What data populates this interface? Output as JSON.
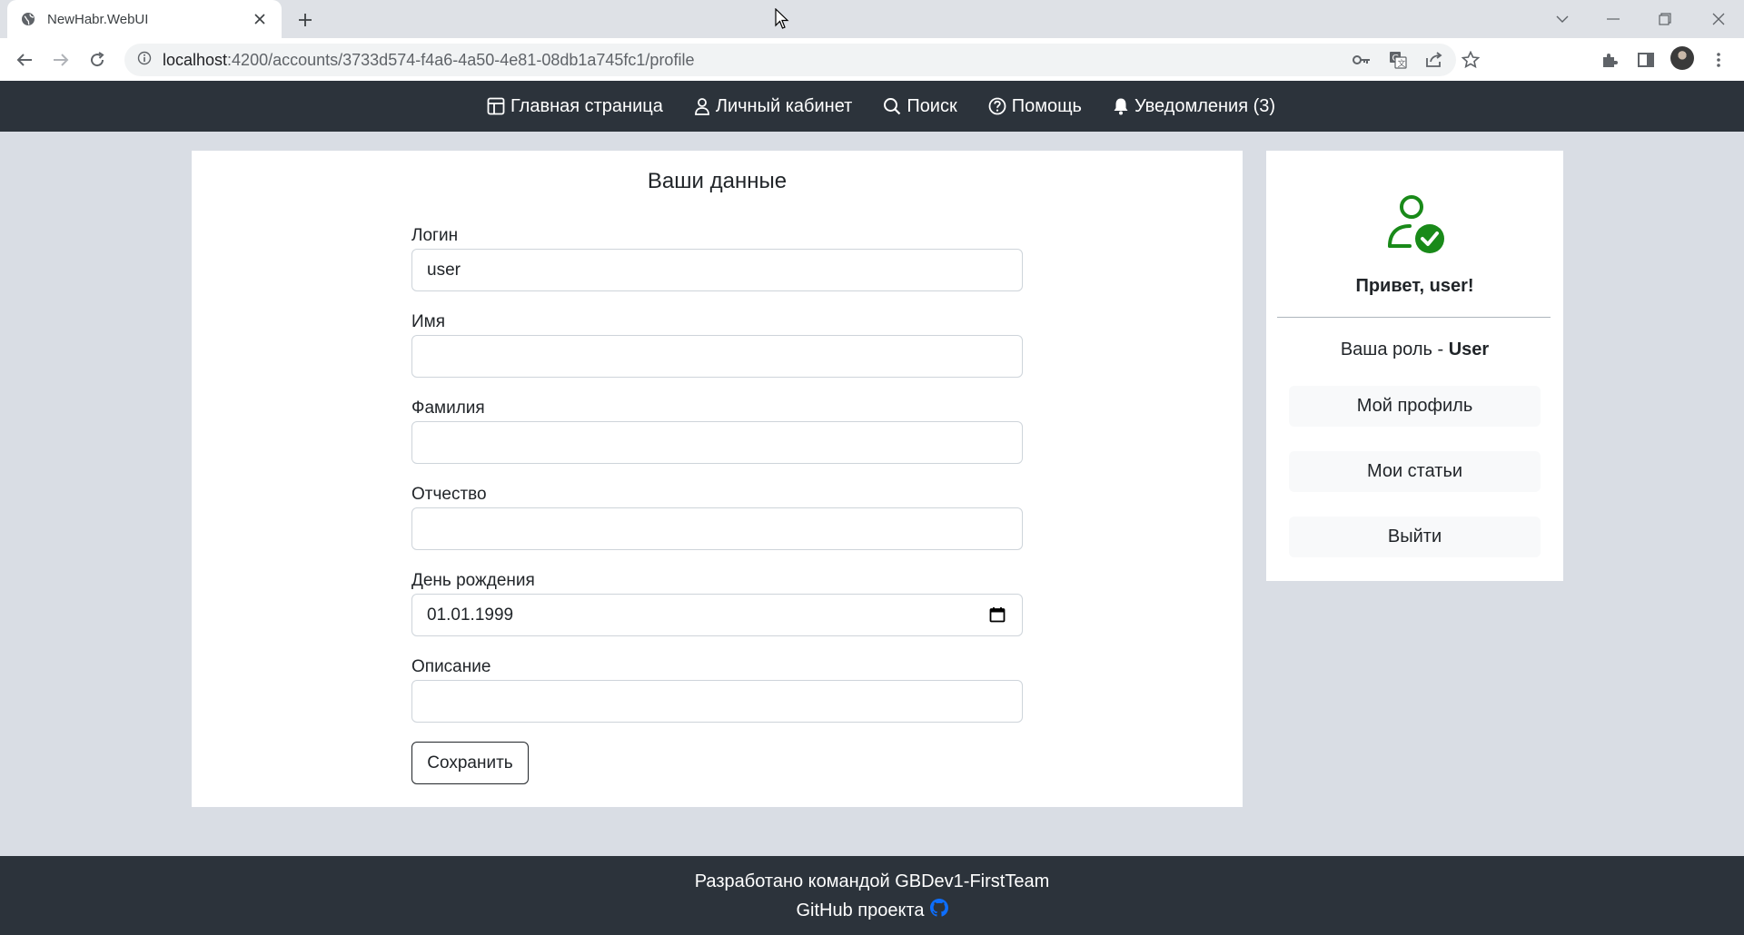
{
  "browser": {
    "tab_title": "NewHabr.WebUI",
    "url_host": "localhost",
    "url_rest": ":4200/accounts/3733d574-f4a6-4a50-4e81-08db1a745fc1/profile"
  },
  "navbar": {
    "items": [
      {
        "label": "Главная страница",
        "icon": "grid-icon"
      },
      {
        "label": "Личный кабинет",
        "icon": "person-icon"
      },
      {
        "label": "Поиск",
        "icon": "search-icon"
      },
      {
        "label": "Помощь",
        "icon": "question-icon"
      },
      {
        "label": "Уведомления (3)",
        "icon": "bell-icon"
      }
    ]
  },
  "form": {
    "title": "Ваши данные",
    "fields": [
      {
        "label": "Логин",
        "value": "user"
      },
      {
        "label": "Имя",
        "value": ""
      },
      {
        "label": "Фамилия",
        "value": ""
      },
      {
        "label": "Отчество",
        "value": ""
      },
      {
        "label": "День рождения",
        "value": "01.01.1999"
      },
      {
        "label": "Описание",
        "value": ""
      }
    ],
    "save_label": "Сохранить"
  },
  "sidebar": {
    "greeting": "Привет, user!",
    "role_prefix": "Ваша роль - ",
    "role_value": "User",
    "buttons": [
      "Мой профиль",
      "Мои статьи",
      "Выйти"
    ]
  },
  "footer": {
    "line1": "Разработано командой GBDev1-FirstTeam",
    "line2": "GitHub проекта"
  },
  "colors": {
    "navbar_bg": "#2c333b",
    "page_bg": "#d9dde4",
    "user_icon": "#198a19",
    "github_icon": "#0d6efd"
  }
}
